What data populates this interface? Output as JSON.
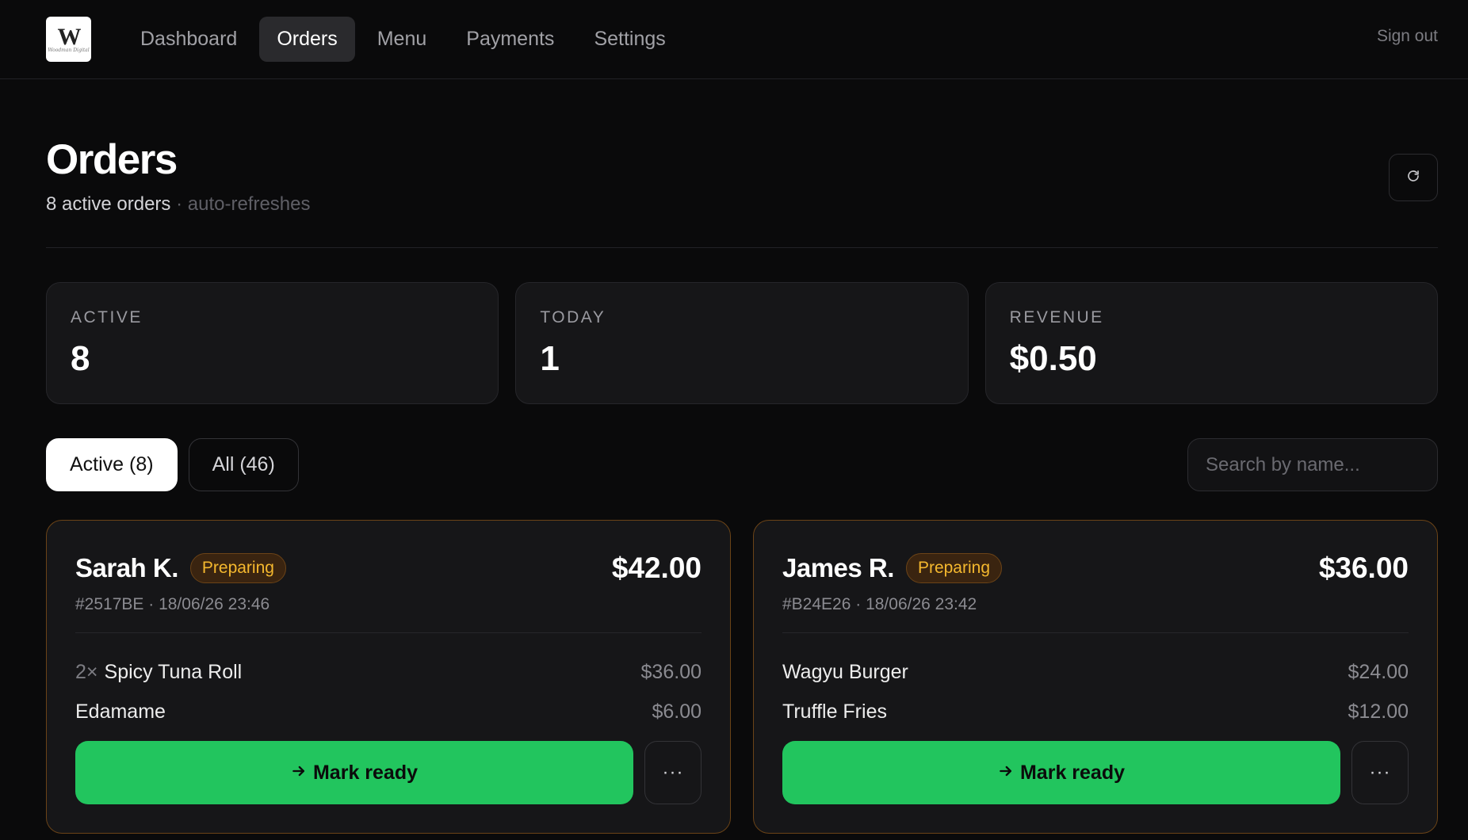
{
  "app": {
    "logo_mark": "W",
    "logo_script": "Woodman Digital"
  },
  "nav": {
    "items": [
      {
        "label": "Dashboard",
        "active": false
      },
      {
        "label": "Orders",
        "active": true
      },
      {
        "label": "Menu",
        "active": false
      },
      {
        "label": "Payments",
        "active": false
      },
      {
        "label": "Settings",
        "active": false
      }
    ],
    "signout_label": "Sign out"
  },
  "header": {
    "title": "Orders",
    "active_count_text": "8 active orders",
    "separator": "·",
    "refresh_note": "auto-refreshes",
    "refresh_icon": "refresh-icon"
  },
  "stats": [
    {
      "label": "ACTIVE",
      "value": "8"
    },
    {
      "label": "TODAY",
      "value": "1"
    },
    {
      "label": "REVENUE",
      "value": "$0.50"
    }
  ],
  "filters": {
    "active_label": "Active (8)",
    "all_label": "All (46)",
    "search_placeholder": "Search by name..."
  },
  "colors": {
    "accent_green": "#22c55e",
    "status_amber": "#f5b82e",
    "card_border_amber": "#6b4317"
  },
  "orders": [
    {
      "customer": "Sarah K.",
      "status": "Preparing",
      "total": "$42.00",
      "meta": "#2517BE · 18/06/26 23:46",
      "items": [
        {
          "qty": "2×",
          "name": "Spicy Tuna Roll",
          "price": "$36.00"
        },
        {
          "qty": "",
          "name": "Edamame",
          "price": "$6.00"
        }
      ],
      "action_label": "Mark ready",
      "action_icon": "arrow-right-icon",
      "more_label": "···"
    },
    {
      "customer": "James R.",
      "status": "Preparing",
      "total": "$36.00",
      "meta": "#B24E26 · 18/06/26 23:42",
      "items": [
        {
          "qty": "",
          "name": "Wagyu Burger",
          "price": "$24.00"
        },
        {
          "qty": "",
          "name": "Truffle Fries",
          "price": "$12.00"
        }
      ],
      "action_label": "Mark ready",
      "action_icon": "arrow-right-icon",
      "more_label": "···"
    }
  ]
}
